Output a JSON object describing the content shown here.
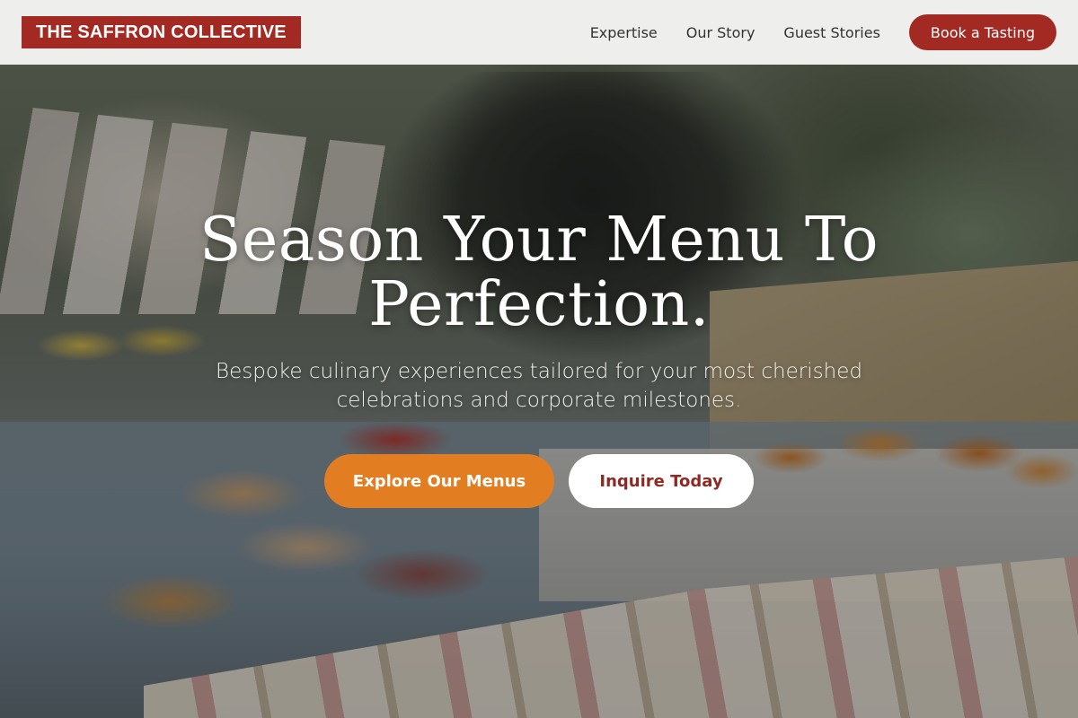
{
  "header": {
    "logo": "THE SAFFRON COLLECTIVE",
    "nav": [
      {
        "label": "Expertise"
      },
      {
        "label": "Our Story"
      },
      {
        "label": "Guest Stories"
      }
    ],
    "cta_label": "Book a Tasting"
  },
  "hero": {
    "headline_line1": "Season Your Menu To",
    "headline_line2": "Perfection.",
    "subheadline": "Bespoke culinary experiences tailored for your most cherished celebrations and corporate milestones.",
    "primary_cta": "Explore Our Menus",
    "secondary_cta": "Inquire Today"
  },
  "colors": {
    "brand_red": "#a32a23",
    "accent_orange": "#e37d22",
    "header_bg": "#f4f4f2"
  }
}
